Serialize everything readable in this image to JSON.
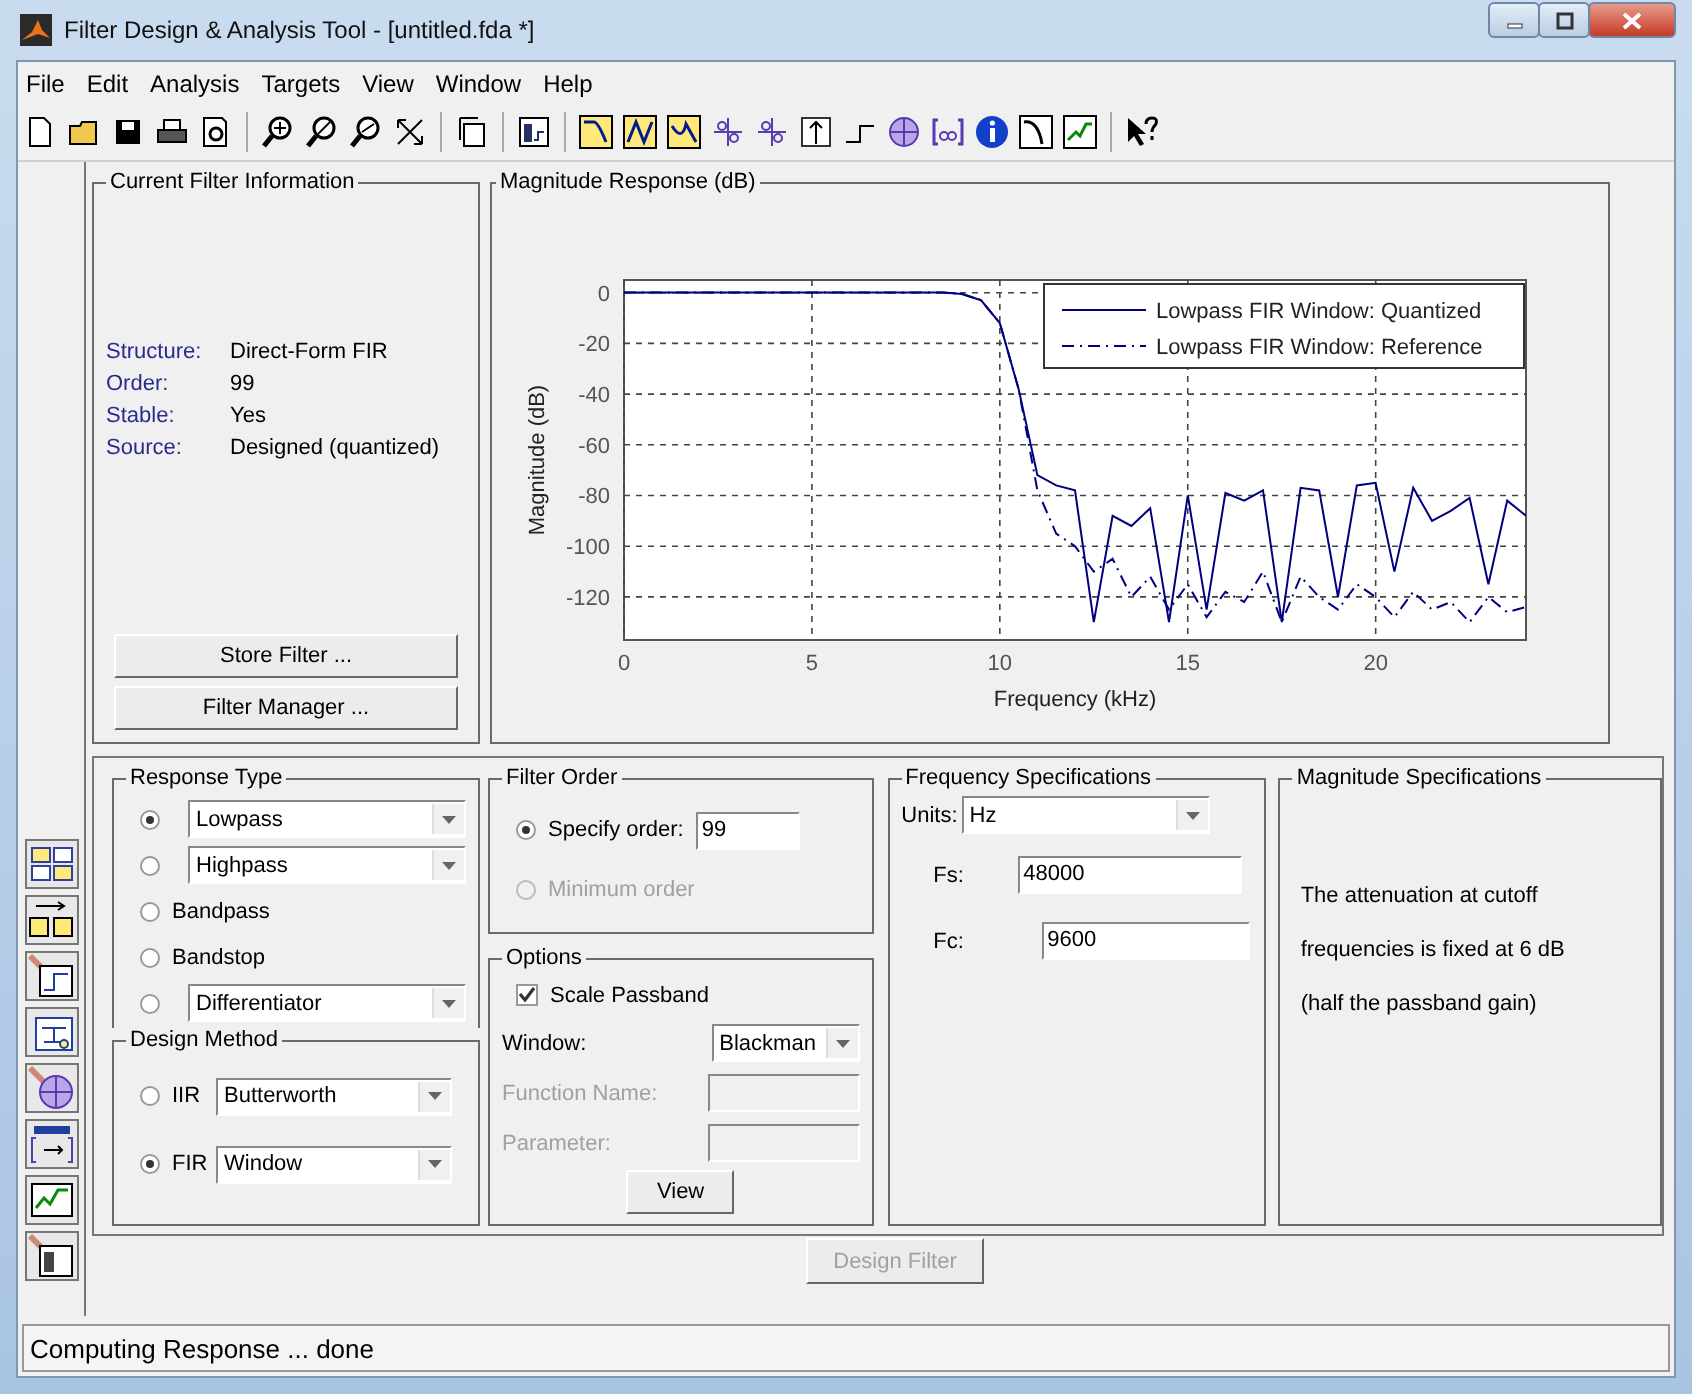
{
  "window": {
    "title": "Filter Design & Analysis Tool -  [untitled.fda *]"
  },
  "menu": [
    "File",
    "Edit",
    "Analysis",
    "Targets",
    "View",
    "Window",
    "Help"
  ],
  "current_filter": {
    "title": "Current Filter Information",
    "fields": [
      {
        "label": "Structure:",
        "value": "Direct-Form FIR"
      },
      {
        "label": "Order:",
        "value": "99"
      },
      {
        "label": "Stable:",
        "value": "Yes"
      },
      {
        "label": "Source:",
        "value": "Designed (quantized)"
      }
    ],
    "buttons": [
      "Store Filter ...",
      "Filter Manager ..."
    ]
  },
  "magnitude_response": {
    "title": "Magnitude Response (dB)",
    "chart_data": {
      "type": "line",
      "xlabel": "Frequency (kHz)",
      "ylabel": "Magnitude (dB)",
      "x": [
        0,
        0.5,
        1,
        1.5,
        2,
        2.5,
        3,
        3.5,
        4,
        4.5,
        5,
        5.5,
        6,
        6.5,
        7,
        7.5,
        8,
        8.5,
        9,
        9.5,
        10,
        10.5,
        11,
        11.5,
        12,
        12.5,
        13,
        13.5,
        14,
        14.5,
        15,
        15.5,
        16,
        16.5,
        17,
        17.5,
        18,
        18.5,
        19,
        19.5,
        20,
        20.5,
        21,
        21.5,
        22,
        22.5,
        23,
        23.5,
        24
      ],
      "grid": true,
      "legend": true,
      "series": [
        {
          "name": "Lowpass FIR Window: Quantized",
          "color": "#00007f",
          "line_style": "solid",
          "values": [
            0,
            0,
            0,
            0,
            0,
            0,
            0,
            0,
            0,
            0,
            0,
            0,
            0,
            0,
            0,
            0,
            0,
            0,
            -0.5,
            -3,
            -12,
            -38,
            -72,
            -76,
            -78,
            -130,
            -88,
            -92,
            -85,
            -130,
            -80,
            -125,
            -79,
            -82,
            -78,
            -130,
            -77,
            -78,
            -120,
            -76,
            -75,
            -110,
            -77,
            -90,
            -86,
            -81,
            -115,
            -82,
            -88
          ]
        },
        {
          "name": "Lowpass FIR Window: Reference",
          "color": "#00007f",
          "line_style": "dashdot",
          "values": [
            0,
            0,
            0,
            0,
            0,
            0,
            0,
            0,
            0,
            0,
            0,
            0,
            0,
            0,
            0,
            0,
            0,
            0,
            -0.5,
            -3,
            -12,
            -38,
            -78,
            -95,
            -100,
            -110,
            -105,
            -120,
            -112,
            -125,
            -115,
            -128,
            -118,
            -122,
            -110,
            -130,
            -112,
            -120,
            -125,
            -115,
            -120,
            -128,
            -118,
            -125,
            -122,
            -130,
            -120,
            -126,
            -124
          ]
        }
      ],
      "xlim": [
        0,
        24
      ],
      "ylim": [
        -137,
        5
      ],
      "xticks": [
        0,
        5,
        10,
        15,
        20
      ],
      "yticks": [
        -120,
        -100,
        -80,
        -60,
        -40,
        -20,
        0
      ]
    }
  },
  "response_type": {
    "title": "Response Type",
    "options": [
      {
        "kind": "select",
        "selected": true,
        "value": "Lowpass"
      },
      {
        "kind": "select",
        "selected": false,
        "value": "Highpass"
      },
      {
        "kind": "label",
        "selected": false,
        "label": "Bandpass"
      },
      {
        "kind": "label",
        "selected": false,
        "label": "Bandstop"
      },
      {
        "kind": "select",
        "selected": false,
        "value": "Differentiator"
      }
    ]
  },
  "design_method": {
    "title": "Design Method",
    "options": [
      {
        "label": "IIR",
        "selected": false,
        "value": "Butterworth"
      },
      {
        "label": "FIR",
        "selected": true,
        "value": "Window"
      }
    ]
  },
  "filter_order": {
    "title": "Filter Order",
    "options": [
      {
        "label": "Specify order:",
        "selected": true,
        "disabled": false,
        "value": "99"
      },
      {
        "label": "Minimum order",
        "selected": false,
        "disabled": true
      }
    ]
  },
  "options": {
    "title": "Options",
    "scale_passband": {
      "label": "Scale Passband",
      "checked": true
    },
    "fields": [
      {
        "kind": "select",
        "label": "Window:",
        "disabled": false,
        "value": "Blackman"
      },
      {
        "kind": "input",
        "label": "Function Name:",
        "disabled": true
      },
      {
        "kind": "input",
        "label": "Parameter:",
        "disabled": true
      }
    ],
    "button": "View"
  },
  "frequency_specs": {
    "title": "Frequency Specifications",
    "units": {
      "label": "Units:",
      "value": "Hz"
    },
    "fields": [
      {
        "label": "Fs:",
        "value": "48000"
      },
      {
        "label": "Fc:",
        "value": "9600"
      }
    ]
  },
  "magnitude_specs": {
    "title": "Magnitude Specifications",
    "lines": [
      "The attenuation at cutoff",
      "frequencies is fixed at 6 dB",
      "(half the passband gain)"
    ]
  },
  "design_button": {
    "label": "Design Filter",
    "disabled": true
  },
  "status_bar": "Computing Response ... done"
}
